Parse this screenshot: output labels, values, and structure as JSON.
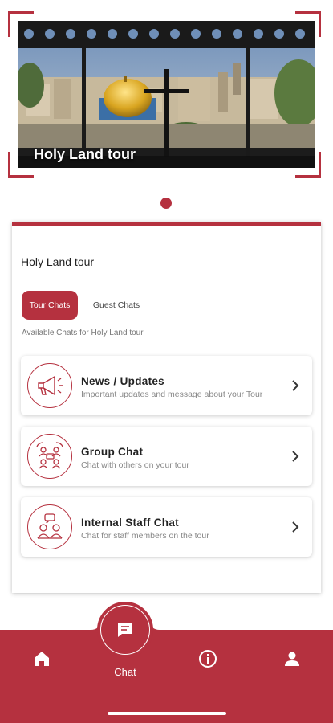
{
  "hero": {
    "title": "Holy Land tour"
  },
  "carousel": {
    "active_index": 0,
    "count": 1
  },
  "card": {
    "title": "Holy Land tour",
    "tabs": [
      {
        "label": "Tour Chats",
        "active": true
      },
      {
        "label": "Guest Chats",
        "active": false
      }
    ],
    "subtitle": "Available Chats for Holy Land tour",
    "chats": [
      {
        "name": "News / Updates",
        "description": "Important updates and message about your Tour",
        "icon": "megaphone-icon"
      },
      {
        "name": "Group Chat",
        "description": "Chat with others on your tour",
        "icon": "group-chat-icon"
      },
      {
        "name": "Internal Staff Chat",
        "description": "Chat for staff members on the tour",
        "icon": "staff-chat-icon"
      }
    ]
  },
  "nav": {
    "items": [
      {
        "name": "home",
        "icon": "home-icon"
      },
      {
        "name": "chat",
        "icon": "chat-icon",
        "label": "Chat",
        "active": true
      },
      {
        "name": "info",
        "icon": "info-icon"
      },
      {
        "name": "profile",
        "icon": "person-icon"
      }
    ]
  },
  "colors": {
    "accent": "#b5313f",
    "background": "#ffffff"
  }
}
